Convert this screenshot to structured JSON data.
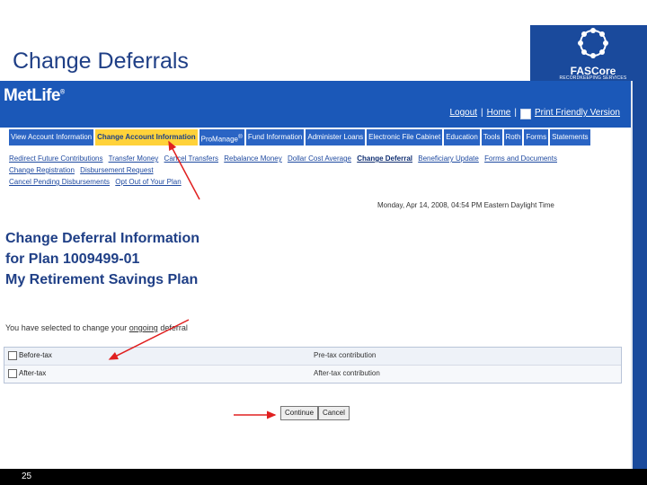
{
  "slide": {
    "title": "Change Deferrals",
    "page_number": "25"
  },
  "vendor": {
    "name": "FASCore",
    "tagline": "RECORDKEEPING SERVICES"
  },
  "app": {
    "brand": "MetLife",
    "utility_links": [
      "Logout",
      "Home",
      "Print Friendly Version"
    ],
    "nav_tabs": [
      "View Account Information",
      "Change Account Information",
      "ProManage",
      "Fund Information",
      "Administer Loans",
      "Electronic File Cabinet",
      "Education",
      "Tools",
      "Roth",
      "Forms",
      "Statements"
    ],
    "active_tab_index": 1,
    "sub_nav": [
      "Redirect Future Contributions",
      "Transfer Money",
      "Cancel Transfers",
      "Rebalance Money",
      "Dollar Cost Average",
      "Change Deferral",
      "Beneficiary Update",
      "Forms and Documents",
      "Change Registration",
      "Disbursement Request",
      "Cancel Pending Disbursements",
      "Opt Out of Your Plan"
    ],
    "current_sub_nav_index": 5,
    "datetime": "Monday, Apr 14, 2008, 04:54 PM Eastern Daylight Time",
    "heading_lines": [
      "Change Deferral Information",
      "for Plan 1009499-01",
      "My Retirement Savings Plan"
    ],
    "prompt_before": "You have selected to change your ",
    "prompt_link": "ongoing",
    "prompt_after": " deferral",
    "options": [
      {
        "label": "Before-tax",
        "description": "Pre-tax contribution",
        "checked": false
      },
      {
        "label": "After-tax",
        "description": "After-tax contribution",
        "checked": false
      }
    ],
    "buttons": {
      "continue": "Continue",
      "cancel": "Cancel"
    }
  },
  "colors": {
    "header_blue": "#1b58b8",
    "active_tab": "#ffd23a",
    "arrow": "#e02020"
  }
}
